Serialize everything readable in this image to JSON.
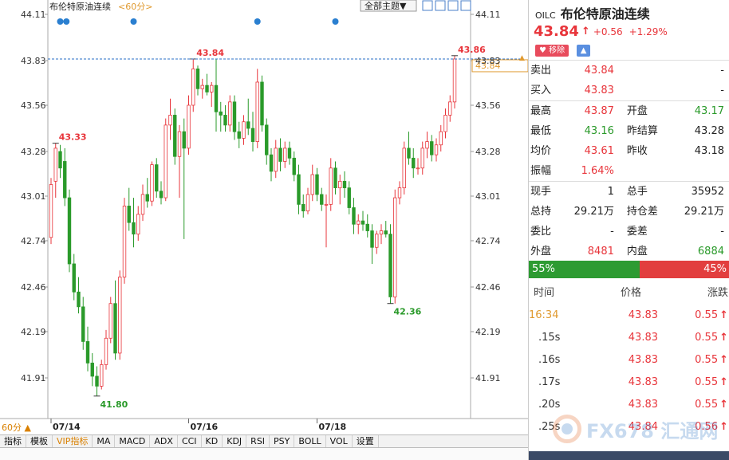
{
  "chart": {
    "title": "布伦特原油连续",
    "period_tag": "<60分>",
    "theme_select": "全部主题▼",
    "period_label": "60分 ▲",
    "y_ticks": [
      "44.11",
      "43.83",
      "43.56",
      "43.28",
      "43.01",
      "42.74",
      "42.46",
      "42.19",
      "41.91"
    ],
    "x_dates": [
      "07/14",
      "07/16",
      "07/18"
    ],
    "last_price_tag": "43.84",
    "annotations": {
      "high1": "43.33",
      "high2": "43.84",
      "high3": "43.86",
      "low1": "41.80",
      "low2": "42.36"
    }
  },
  "chart_data": {
    "type": "candlestick",
    "title": "布伦特原油连续",
    "ylim": [
      41.72,
      44.18
    ],
    "x_dates": [
      "07/14",
      "07/16",
      "07/18"
    ],
    "annotations": [
      {
        "label": "43.33",
        "value": 43.33
      },
      {
        "label": "41.80",
        "value": 41.8
      },
      {
        "label": "43.84",
        "value": 43.84
      },
      {
        "label": "42.36",
        "value": 42.36
      },
      {
        "label": "43.86",
        "value": 43.86
      }
    ],
    "series": [
      {
        "values": [
          {
            "o": 42.76,
            "h": 43.12,
            "l": 42.72,
            "c": 43.08
          },
          {
            "o": 43.1,
            "h": 43.33,
            "l": 43.0,
            "c": 43.3
          },
          {
            "o": 43.28,
            "h": 43.32,
            "l": 43.12,
            "c": 43.18
          },
          {
            "o": 43.22,
            "h": 43.3,
            "l": 42.95,
            "c": 43.0
          },
          {
            "o": 43.0,
            "h": 43.05,
            "l": 42.55,
            "c": 42.6
          },
          {
            "o": 42.6,
            "h": 42.66,
            "l": 42.38,
            "c": 42.43
          },
          {
            "o": 42.43,
            "h": 42.52,
            "l": 42.3,
            "c": 42.34
          },
          {
            "o": 42.34,
            "h": 42.4,
            "l": 42.08,
            "c": 42.13
          },
          {
            "o": 42.13,
            "h": 42.22,
            "l": 41.95,
            "c": 42.0
          },
          {
            "o": 42.0,
            "h": 42.06,
            "l": 41.86,
            "c": 41.92
          },
          {
            "o": 41.92,
            "h": 41.98,
            "l": 41.8,
            "c": 41.86
          },
          {
            "o": 41.86,
            "h": 42.02,
            "l": 41.84,
            "c": 41.99
          },
          {
            "o": 41.99,
            "h": 42.2,
            "l": 41.96,
            "c": 42.15
          },
          {
            "o": 42.15,
            "h": 42.4,
            "l": 42.12,
            "c": 42.36
          },
          {
            "o": 42.36,
            "h": 42.5,
            "l": 42.02,
            "c": 42.06
          },
          {
            "o": 42.06,
            "h": 42.56,
            "l": 42.02,
            "c": 42.52
          },
          {
            "o": 42.52,
            "h": 43.0,
            "l": 42.48,
            "c": 42.95
          },
          {
            "o": 42.95,
            "h": 43.06,
            "l": 42.8,
            "c": 42.85
          },
          {
            "o": 42.85,
            "h": 43.0,
            "l": 42.7,
            "c": 42.78
          },
          {
            "o": 42.78,
            "h": 42.95,
            "l": 42.74,
            "c": 42.9
          },
          {
            "o": 42.9,
            "h": 43.08,
            "l": 42.86,
            "c": 43.02
          },
          {
            "o": 43.02,
            "h": 43.12,
            "l": 42.94,
            "c": 42.98
          },
          {
            "o": 42.98,
            "h": 43.22,
            "l": 42.95,
            "c": 43.2
          },
          {
            "o": 43.2,
            "h": 43.24,
            "l": 43.0,
            "c": 43.04
          },
          {
            "o": 43.04,
            "h": 43.1,
            "l": 42.96,
            "c": 43.0
          },
          {
            "o": 43.0,
            "h": 43.48,
            "l": 42.98,
            "c": 43.44
          },
          {
            "o": 43.44,
            "h": 43.6,
            "l": 43.35,
            "c": 43.5
          },
          {
            "o": 43.5,
            "h": 43.54,
            "l": 43.2,
            "c": 43.25
          },
          {
            "o": 43.25,
            "h": 43.44,
            "l": 43.0,
            "c": 43.4
          },
          {
            "o": 43.4,
            "h": 43.48,
            "l": 42.75,
            "c": 43.3
          },
          {
            "o": 43.3,
            "h": 43.62,
            "l": 43.26,
            "c": 43.56
          },
          {
            "o": 43.56,
            "h": 43.84,
            "l": 43.52,
            "c": 43.78
          },
          {
            "o": 43.78,
            "h": 43.8,
            "l": 43.62,
            "c": 43.66
          },
          {
            "o": 43.66,
            "h": 43.72,
            "l": 43.6,
            "c": 43.68
          },
          {
            "o": 43.68,
            "h": 43.75,
            "l": 43.62,
            "c": 43.64
          },
          {
            "o": 43.64,
            "h": 43.7,
            "l": 43.55,
            "c": 43.68
          },
          {
            "o": 43.68,
            "h": 43.84,
            "l": 43.4,
            "c": 43.52
          },
          {
            "o": 43.52,
            "h": 43.58,
            "l": 43.4,
            "c": 43.5
          },
          {
            "o": 43.5,
            "h": 43.56,
            "l": 43.4,
            "c": 43.44
          },
          {
            "o": 43.44,
            "h": 43.62,
            "l": 43.4,
            "c": 43.58
          },
          {
            "o": 43.58,
            "h": 43.62,
            "l": 43.35,
            "c": 43.4
          },
          {
            "o": 43.4,
            "h": 43.46,
            "l": 43.3,
            "c": 43.36
          },
          {
            "o": 43.36,
            "h": 43.5,
            "l": 43.32,
            "c": 43.46
          },
          {
            "o": 43.46,
            "h": 43.6,
            "l": 43.38,
            "c": 43.42
          },
          {
            "o": 43.42,
            "h": 43.52,
            "l": 43.28,
            "c": 43.34
          },
          {
            "o": 43.34,
            "h": 43.78,
            "l": 43.3,
            "c": 43.7
          },
          {
            "o": 43.7,
            "h": 43.74,
            "l": 43.4,
            "c": 43.44
          },
          {
            "o": 43.44,
            "h": 43.48,
            "l": 43.2,
            "c": 43.26
          },
          {
            "o": 43.26,
            "h": 43.3,
            "l": 43.1,
            "c": 43.16
          },
          {
            "o": 43.16,
            "h": 43.35,
            "l": 43.12,
            "c": 43.3
          },
          {
            "o": 43.3,
            "h": 43.36,
            "l": 43.16,
            "c": 43.22
          },
          {
            "o": 43.22,
            "h": 43.34,
            "l": 43.18,
            "c": 43.3
          },
          {
            "o": 43.3,
            "h": 43.34,
            "l": 43.2,
            "c": 43.24
          },
          {
            "o": 43.24,
            "h": 43.28,
            "l": 43.1,
            "c": 43.14
          },
          {
            "o": 43.14,
            "h": 43.2,
            "l": 42.9,
            "c": 42.96
          },
          {
            "o": 42.96,
            "h": 43.02,
            "l": 42.88,
            "c": 42.92
          },
          {
            "o": 42.92,
            "h": 43.06,
            "l": 42.9,
            "c": 43.02
          },
          {
            "o": 43.02,
            "h": 43.2,
            "l": 42.98,
            "c": 43.14
          },
          {
            "o": 43.14,
            "h": 43.18,
            "l": 42.98,
            "c": 43.02
          },
          {
            "o": 43.02,
            "h": 43.06,
            "l": 42.92,
            "c": 42.96
          },
          {
            "o": 42.96,
            "h": 43.02,
            "l": 42.7,
            "c": 42.96
          },
          {
            "o": 42.96,
            "h": 43.24,
            "l": 42.92,
            "c": 43.18
          },
          {
            "o": 43.18,
            "h": 43.22,
            "l": 43.02,
            "c": 43.06
          },
          {
            "o": 43.06,
            "h": 43.14,
            "l": 42.96,
            "c": 43.1
          },
          {
            "o": 43.1,
            "h": 43.16,
            "l": 43.0,
            "c": 43.06
          },
          {
            "o": 43.06,
            "h": 43.1,
            "l": 42.9,
            "c": 42.94
          },
          {
            "o": 42.94,
            "h": 43.0,
            "l": 42.78,
            "c": 42.84
          },
          {
            "o": 42.84,
            "h": 42.9,
            "l": 42.78,
            "c": 42.86
          },
          {
            "o": 42.86,
            "h": 42.92,
            "l": 42.8,
            "c": 42.84
          },
          {
            "o": 42.84,
            "h": 42.9,
            "l": 42.76,
            "c": 42.8
          },
          {
            "o": 42.8,
            "h": 42.84,
            "l": 42.6,
            "c": 42.7
          },
          {
            "o": 42.7,
            "h": 42.8,
            "l": 42.66,
            "c": 42.78
          },
          {
            "o": 42.78,
            "h": 42.84,
            "l": 42.72,
            "c": 42.8
          },
          {
            "o": 42.8,
            "h": 42.86,
            "l": 42.76,
            "c": 42.78
          },
          {
            "o": 42.78,
            "h": 42.84,
            "l": 42.36,
            "c": 42.4
          },
          {
            "o": 42.4,
            "h": 43.05,
            "l": 42.36,
            "c": 43.0
          },
          {
            "o": 43.0,
            "h": 43.1,
            "l": 42.96,
            "c": 43.06
          },
          {
            "o": 43.06,
            "h": 43.34,
            "l": 43.02,
            "c": 43.3
          },
          {
            "o": 43.3,
            "h": 43.4,
            "l": 43.2,
            "c": 43.24
          },
          {
            "o": 43.24,
            "h": 43.3,
            "l": 43.12,
            "c": 43.18
          },
          {
            "o": 43.18,
            "h": 43.24,
            "l": 43.14,
            "c": 43.18
          },
          {
            "o": 43.18,
            "h": 43.34,
            "l": 43.14,
            "c": 43.3
          },
          {
            "o": 43.3,
            "h": 43.4,
            "l": 43.24,
            "c": 43.34
          },
          {
            "o": 43.34,
            "h": 43.38,
            "l": 43.22,
            "c": 43.26
          },
          {
            "o": 43.26,
            "h": 43.36,
            "l": 43.22,
            "c": 43.32
          },
          {
            "o": 43.32,
            "h": 43.44,
            "l": 43.28,
            "c": 43.4
          },
          {
            "o": 43.4,
            "h": 43.54,
            "l": 43.36,
            "c": 43.5
          },
          {
            "o": 43.5,
            "h": 43.62,
            "l": 43.46,
            "c": 43.58
          },
          {
            "o": 43.58,
            "h": 43.86,
            "l": 43.54,
            "c": 43.84
          }
        ]
      }
    ]
  },
  "indicators": [
    "指标",
    "模板",
    "VIP指标",
    "MA",
    "MACD",
    "ADX",
    "CCI",
    "KD",
    "KDJ",
    "RSI",
    "PSY",
    "BOLL",
    "VOL",
    "设置"
  ],
  "quote": {
    "code": "OILC",
    "name": "布伦特原油连续",
    "price": "43.84",
    "arrow": "↑",
    "change": "+0.56",
    "change_pct": "+1.29%",
    "remove_btn": "移除",
    "bell_btn": "▲",
    "rows": [
      {
        "l1": "卖出",
        "v1": "43.84",
        "l2": "",
        "v2": "-"
      },
      {
        "l1": "买入",
        "v1": "43.83",
        "l2": "",
        "v2": "-"
      },
      {
        "l1": "最高",
        "v1": "43.87",
        "l2": "开盘",
        "v2": "43.17"
      },
      {
        "l1": "最低",
        "v1": "43.16",
        "l2": "昨结算",
        "v2": "43.28"
      },
      {
        "l1": "均价",
        "v1": "43.61",
        "l2": "昨收",
        "v2": "43.18"
      },
      {
        "l1": "振幅",
        "v1": "1.64%",
        "l2": "",
        "v2": ""
      },
      {
        "l1": "现手",
        "v1": "1",
        "l2": "总手",
        "v2": "35952"
      },
      {
        "l1": "总持",
        "v1": "29.21万",
        "l2": "持仓差",
        "v2": "29.21万"
      },
      {
        "l1": "委比",
        "v1": "-",
        "l2": "委差",
        "v2": "-"
      },
      {
        "l1": "外盘",
        "v1": "8481",
        "l2": "内盘",
        "v2": "6884"
      }
    ],
    "buy_pct": "55%",
    "sell_pct": "45%",
    "buy_ratio": 0.55
  },
  "ticks": {
    "headers": [
      "时间",
      "价格",
      "涨跌"
    ],
    "rows": [
      {
        "time": "16:34",
        "price": "43.83",
        "chg": "0.55"
      },
      {
        "time": ".15s",
        "price": "43.83",
        "chg": "0.55"
      },
      {
        "time": ".16s",
        "price": "43.83",
        "chg": "0.55"
      },
      {
        "time": ".17s",
        "price": "43.83",
        "chg": "0.55"
      },
      {
        "time": ".20s",
        "price": "43.83",
        "chg": "0.55"
      },
      {
        "time": ".25s",
        "price": "43.84",
        "chg": "0.56"
      }
    ],
    "up_arrow": "↑"
  },
  "watermark": "FX678 汇通网",
  "colors": {
    "up": "#e8353b",
    "down": "#2a9a2a",
    "accent": "#e09a30",
    "link": "#3a7cc7"
  }
}
